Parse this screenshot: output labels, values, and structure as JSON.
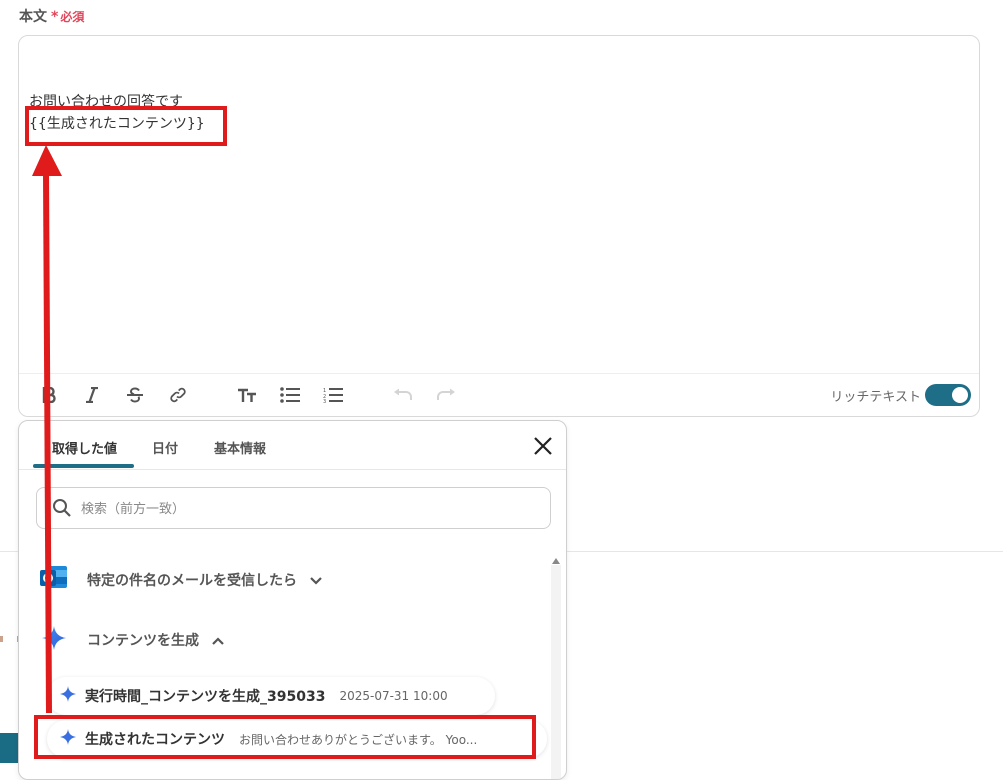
{
  "field": {
    "label": "本文",
    "required_mark": "*",
    "required_text": "必須"
  },
  "editor": {
    "lines": [
      "お問い合わせの回答です",
      "{{生成されたコンテンツ}}"
    ],
    "toolbar": {
      "buttons": [
        "bold-icon",
        "italic-icon",
        "strikethrough-icon",
        "link-icon",
        "text-size-icon",
        "bullet-list-icon",
        "numbered-list-icon",
        "undo-icon",
        "redo-icon"
      ],
      "rich_text_label": "リッチテキスト",
      "rich_text_enabled": true
    }
  },
  "panel": {
    "tabs": [
      "取得した値",
      "日付",
      "基本情報"
    ],
    "active_tab": "取得した値",
    "search_placeholder": "検索（前方一致）",
    "groups": [
      {
        "label": "特定の件名のメールを受信したら",
        "icon": "outlook-icon",
        "expanded": false
      },
      {
        "label": "コンテンツを生成",
        "icon": "sparkle-icon",
        "expanded": true
      }
    ],
    "items": [
      {
        "name": "実行時間_コンテンツを生成_395033",
        "value": "2025-07-31 10:00"
      },
      {
        "name": "生成されたコンテンツ",
        "value": "お問い合わせありがとうございます。 Yoo..."
      }
    ]
  },
  "colors": {
    "accent": "#1f6e87",
    "required": "#e0475b",
    "annotation": "#e01b1b"
  }
}
